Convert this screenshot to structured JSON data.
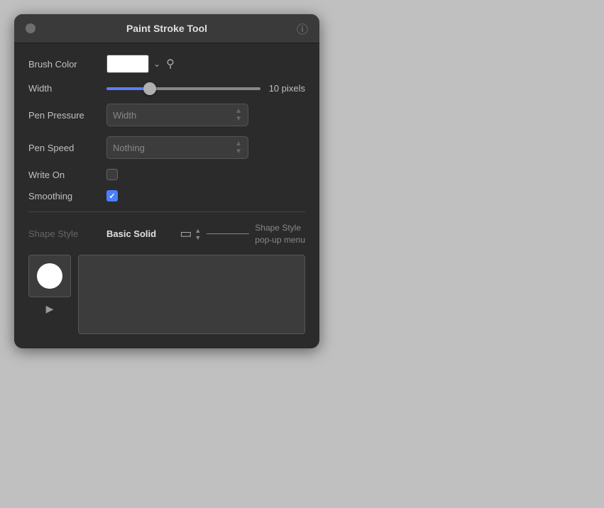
{
  "window": {
    "title": "Paint Stroke Tool"
  },
  "brushColor": {
    "label": "Brush Color"
  },
  "width": {
    "label": "Width",
    "sliderValue": "10 pixels",
    "sliderPercent": 28
  },
  "penPressure": {
    "label": "Pen Pressure",
    "value": "Width"
  },
  "penSpeed": {
    "label": "Pen Speed",
    "value": "Nothing"
  },
  "writeOn": {
    "label": "Write On",
    "checked": false
  },
  "smoothing": {
    "label": "Smoothing",
    "checked": true
  },
  "shapeStyle": {
    "label": "Shape Style",
    "value": "Basic Solid",
    "annotationLabel": "Shape Style\npop-up menu"
  }
}
